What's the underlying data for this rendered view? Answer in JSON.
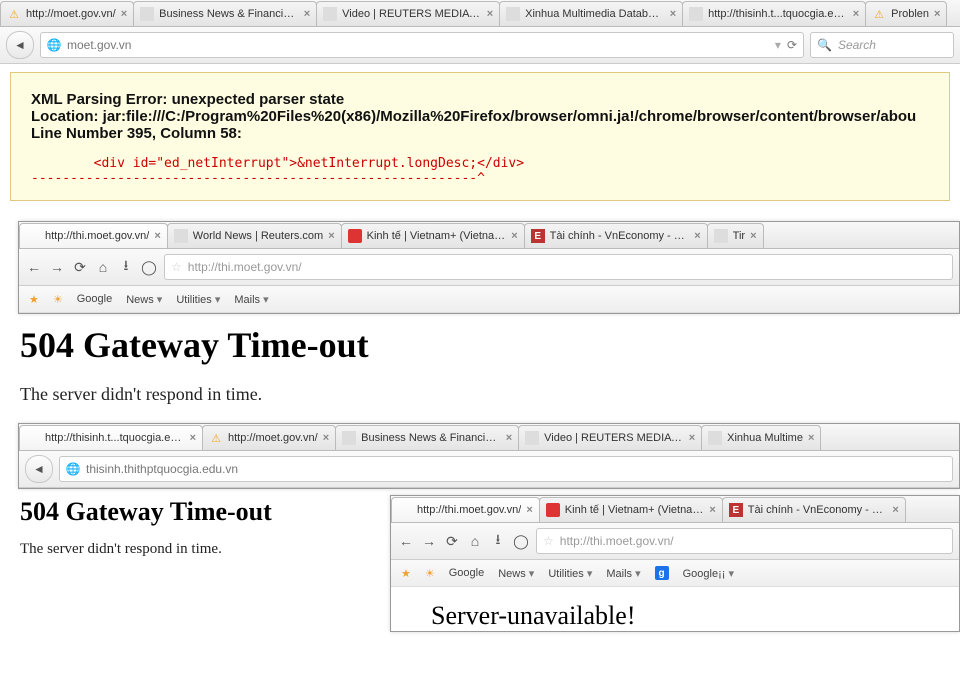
{
  "outer": {
    "tabs": [
      {
        "label": "http://moet.gov.vn/",
        "icon": "warn"
      },
      {
        "label": "Business News & Financial ...",
        "icon": "sq"
      },
      {
        "label": "Video | REUTERS MEDIA E...",
        "icon": "sq"
      },
      {
        "label": "Xinhua Multimedia Database",
        "icon": "sq"
      },
      {
        "label": "http://thisinh.t...tquocgia.edu.vn/",
        "icon": "sq"
      },
      {
        "label": "Problen",
        "icon": "warn"
      }
    ],
    "url": "moet.gov.vn",
    "search_placeholder": "Search"
  },
  "xmlerr": {
    "l1": "XML Parsing Error: unexpected parser state",
    "l2": "Location: jar:file:///C:/Program%20Files%20(x86)/Mozilla%20Firefox/browser/omni.ja!/chrome/browser/content/browser/abou",
    "l3": "Line Number 395, Column 58:",
    "code": "        <div id=\"ed_netInterrupt\">&netInterrupt.longDesc;</div>\n---------------------------------------------------------^"
  },
  "win2": {
    "tabs": [
      {
        "label": "http://thi.moet.gov.vn/",
        "icon": "blank",
        "active": true
      },
      {
        "label": "World News | Reuters.com",
        "icon": "sq"
      },
      {
        "label": "Kinh tế | Vietnam+ (VietnamPlus)",
        "icon": "vplus"
      },
      {
        "label": "Tài chính - VnEconomy - Nhịp s...",
        "icon": "ebox"
      },
      {
        "label": "Tir",
        "icon": "sq"
      }
    ],
    "url": "http://thi.moet.gov.vn/",
    "bookmarks": [
      "Google",
      "News",
      "Utilities",
      "Mails"
    ],
    "heading": "504 Gateway Time-out",
    "para": "The server didn't respond in time."
  },
  "win3": {
    "tabs": [
      {
        "label": "http://thisinh.t...tquocgia.edu.vn/",
        "icon": "blank",
        "active": true
      },
      {
        "label": "http://moet.gov.vn/",
        "icon": "warn"
      },
      {
        "label": "Business News & Financial ...",
        "icon": "sq"
      },
      {
        "label": "Video | REUTERS MEDIA E...",
        "icon": "sq"
      },
      {
        "label": "Xinhua Multime",
        "icon": "sq"
      }
    ],
    "url": "thisinh.thithptquocgia.edu.vn",
    "heading": "504 Gateway Time-out",
    "para": "The server didn't respond in time."
  },
  "win4": {
    "tabs": [
      {
        "label": "http://thi.moet.gov.vn/",
        "icon": "blank",
        "active": true
      },
      {
        "label": "Kinh tế | Vietnam+ (VietnamPlus)",
        "icon": "vplus"
      },
      {
        "label": "Tài chính - VnEconomy - Nhịp số...",
        "icon": "ebox"
      }
    ],
    "url": "http://thi.moet.gov.vn/",
    "bookmarks": [
      "Google",
      "News",
      "Utilities",
      "Mails",
      "Google¡¡"
    ],
    "heading": "Server-unavailable!"
  }
}
